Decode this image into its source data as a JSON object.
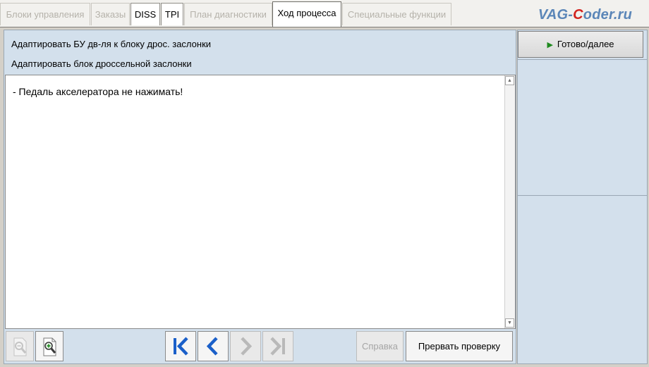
{
  "tabs": [
    {
      "label": "Блоки управления"
    },
    {
      "label": "Заказы"
    },
    {
      "label": "DISS"
    },
    {
      "label": "TPI"
    },
    {
      "label": "План диагностики"
    },
    {
      "label": "Ход процесса"
    },
    {
      "label": "Специальные функции"
    }
  ],
  "active_tab": "Ход процесса",
  "watermark": {
    "prefix": "VAG-",
    "c": "C",
    "suffix": "oder.ru"
  },
  "header": {
    "line1": "Адаптировать БУ дв-ля к блоку дрос. заслонки",
    "line2": "Адаптировать блок дроссельной заслонки"
  },
  "content": {
    "message": "- Педаль акселератора не нажимать!"
  },
  "toolbar": {
    "zoom_out_icon": "zoom-out-icon",
    "zoom_in_icon": "zoom-in-icon",
    "first_icon": "skip-first-icon",
    "prev_icon": "chevron-left-icon",
    "next_icon": "chevron-right-icon",
    "last_icon": "skip-last-icon",
    "help_label": "Справка",
    "abort_label": "Прервать проверку"
  },
  "right": {
    "next_label": "Готово/далее"
  },
  "colors": {
    "accent_blue": "#1a5fc9",
    "panel": "#d3e0ec",
    "go_green": "#1f8a1f"
  }
}
